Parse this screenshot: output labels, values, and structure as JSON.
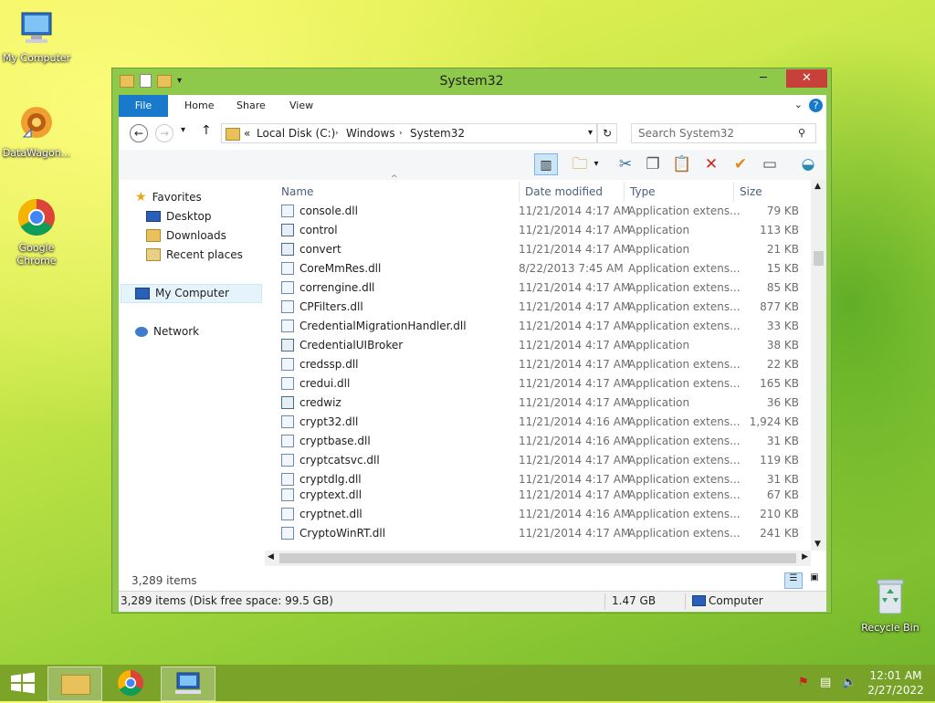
{
  "desktop": {
    "icons": [
      {
        "label": "My Computer",
        "icon": "computer-icon"
      },
      {
        "label": "DataWagon...",
        "icon": "datawagon-icon"
      },
      {
        "label": "Google Chrome",
        "icon": "chrome-icon"
      },
      {
        "label": "Recycle Bin",
        "icon": "recycle-bin-icon"
      }
    ]
  },
  "window": {
    "title": "System32",
    "controls": {
      "minimize": "─",
      "maximize": "☐",
      "close": "✕"
    },
    "ribbon_tabs": [
      "File",
      "Home",
      "Share",
      "View"
    ],
    "address": {
      "prefix": "«",
      "crumbs": [
        "Local Disk (C:)",
        "Windows",
        "System32"
      ]
    },
    "search_placeholder": "Search System32",
    "nav": {
      "favorites": "Favorites",
      "favorites_items": [
        "Desktop",
        "Downloads",
        "Recent places"
      ],
      "my_computer": "My Computer",
      "network": "Network"
    },
    "columns": [
      "Name",
      "Date modified",
      "Type",
      "Size"
    ],
    "files": [
      {
        "name": "console.dll",
        "date": "11/21/2014 4:17 AM",
        "type": "Application extens...",
        "size": "79 KB",
        "kind": "dll"
      },
      {
        "name": "control",
        "date": "11/21/2014 4:17 AM",
        "type": "Application",
        "size": "113 KB",
        "kind": "app"
      },
      {
        "name": "convert",
        "date": "11/21/2014 4:17 AM",
        "type": "Application",
        "size": "21 KB",
        "kind": "app"
      },
      {
        "name": "CoreMmRes.dll",
        "date": "8/22/2013 7:45 AM",
        "type": "Application extens...",
        "size": "15 KB",
        "kind": "dll"
      },
      {
        "name": "correngine.dll",
        "date": "11/21/2014 4:17 AM",
        "type": "Application extens...",
        "size": "85 KB",
        "kind": "dll"
      },
      {
        "name": "CPFilters.dll",
        "date": "11/21/2014 4:17 AM",
        "type": "Application extens...",
        "size": "877 KB",
        "kind": "dll"
      },
      {
        "name": "CredentialMigrationHandler.dll",
        "date": "11/21/2014 4:17 AM",
        "type": "Application extens...",
        "size": "33 KB",
        "kind": "dll"
      },
      {
        "name": "CredentialUIBroker",
        "date": "11/21/2014 4:17 AM",
        "type": "Application",
        "size": "38 KB",
        "kind": "app"
      },
      {
        "name": "credssp.dll",
        "date": "11/21/2014 4:17 AM",
        "type": "Application extens...",
        "size": "22 KB",
        "kind": "dll"
      },
      {
        "name": "credui.dll",
        "date": "11/21/2014 4:17 AM",
        "type": "Application extens...",
        "size": "165 KB",
        "kind": "dll"
      },
      {
        "name": "credwiz",
        "date": "11/21/2014 4:17 AM",
        "type": "Application",
        "size": "36 KB",
        "kind": "app"
      },
      {
        "name": "crypt32.dll",
        "date": "11/21/2014 4:16 AM",
        "type": "Application extens...",
        "size": "1,924 KB",
        "kind": "dll"
      },
      {
        "name": "cryptbase.dll",
        "date": "11/21/2014 4:16 AM",
        "type": "Application extens...",
        "size": "31 KB",
        "kind": "dll"
      },
      {
        "name": "cryptcatsvc.dll",
        "date": "11/21/2014 4:17 AM",
        "type": "Application extens...",
        "size": "119 KB",
        "kind": "dll"
      },
      {
        "name": "cryptdlg.dll",
        "date": "11/21/2014 4:17 AM",
        "type": "Application extens...",
        "size": "31 KB",
        "kind": "dll"
      },
      {
        "name": "cryptext.dll",
        "date": "11/21/2014 4:17 AM",
        "type": "Application extens...",
        "size": "67 KB",
        "kind": "dll"
      },
      {
        "name": "cryptnet.dll",
        "date": "11/21/2014 4:16 AM",
        "type": "Application extens...",
        "size": "210 KB",
        "kind": "dll"
      },
      {
        "name": "CryptoWinRT.dll",
        "date": "11/21/2014 4:17 AM",
        "type": "Application extens...",
        "size": "241 KB",
        "kind": "dll"
      }
    ],
    "item_count": "3,289 items",
    "status": {
      "summary": "3,289 items (Disk free space: 99.5 GB)",
      "size": "1.47 GB",
      "location": "Computer"
    }
  },
  "taskbar": {
    "time": "12:01 AM",
    "date": "2/27/2022"
  },
  "colors": {
    "accent": "#1979ca",
    "window_frame": "#8fc94b"
  }
}
